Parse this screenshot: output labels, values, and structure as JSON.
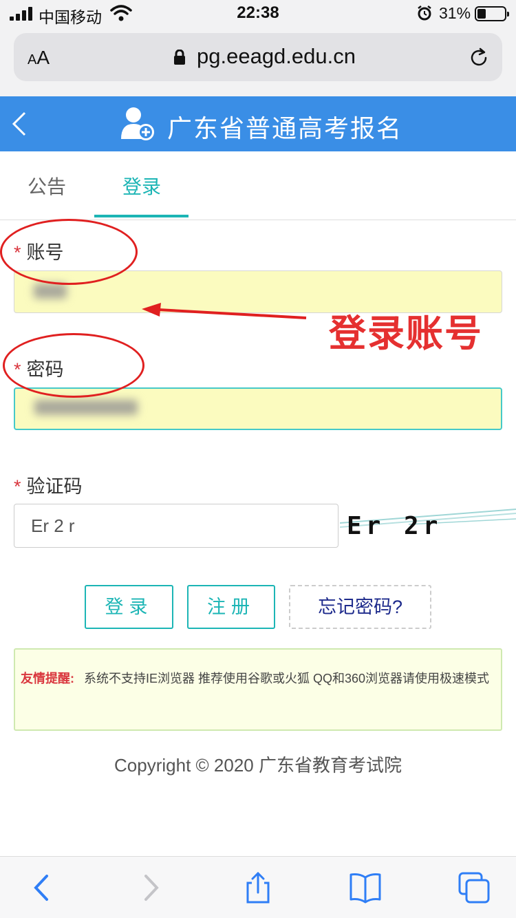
{
  "status_bar": {
    "carrier": "中国移动",
    "time": "22:38",
    "battery_percent": "31%",
    "battery_level": 0.31
  },
  "browser": {
    "aa_label_small": "A",
    "aa_label_large": "A",
    "url": "pg.eeagd.edu.cn"
  },
  "header": {
    "title": "广东省普通高考报名"
  },
  "tabs": [
    {
      "label": "公告",
      "active": false
    },
    {
      "label": "登录",
      "active": true
    }
  ],
  "form": {
    "required_mark": "*",
    "account_label": "账号",
    "password_label": "密码",
    "captcha_label": "验证码",
    "captcha_value": "Er 2 r",
    "captcha_image_text": "Er 2r"
  },
  "buttons": {
    "login": "登录",
    "register": "注册",
    "forgot": "忘记密码?"
  },
  "notice": {
    "label": "友情提醒:",
    "text": "系统不支持IE浏览器 推荐使用谷歌或火狐 QQ和360浏览器请使用极速模式"
  },
  "footer": {
    "copyright": "Copyright © 2020 广东省教育考试院"
  },
  "annotation": {
    "callout": "登录账号"
  },
  "colors": {
    "header_blue": "#3a8ee6",
    "accent_teal": "#1cb5b5",
    "annotation_red": "#e02020"
  }
}
